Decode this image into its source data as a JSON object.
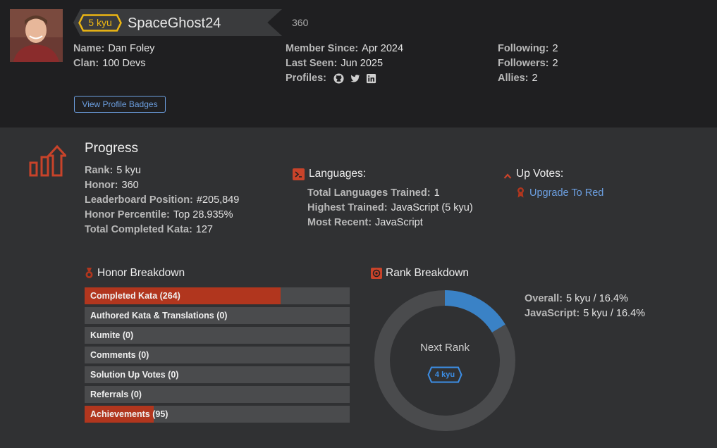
{
  "profile": {
    "rank": "5 kyu",
    "username": "SpaceGhost24",
    "honor": "360",
    "name_label": "Name:",
    "name": "Dan Foley",
    "clan_label": "Clan:",
    "clan": "100 Devs",
    "member_since_label": "Member Since:",
    "member_since": "Apr 2024",
    "last_seen_label": "Last Seen:",
    "last_seen": "Jun 2025",
    "profiles_label": "Profiles:",
    "profile_icons": [
      "github-icon",
      "twitter-icon",
      "linkedin-icon"
    ],
    "following_label": "Following:",
    "following": "2",
    "followers_label": "Followers:",
    "followers": "2",
    "allies_label": "Allies:",
    "allies": "2",
    "badges_button": "View Profile Badges"
  },
  "progress": {
    "title": "Progress",
    "rank_label": "Rank:",
    "rank": "5 kyu",
    "honor_label": "Honor:",
    "honor": "360",
    "leaderboard_label": "Leaderboard Position:",
    "leaderboard": "#205,849",
    "percentile_label": "Honor Percentile:",
    "percentile": "Top 28.935%",
    "completed_label": "Total Completed Kata:",
    "completed": "127"
  },
  "languages": {
    "title": "Languages:",
    "total_label": "Total Languages Trained:",
    "total": "1",
    "highest_label": "Highest Trained:",
    "highest": "JavaScript (5 kyu)",
    "recent_label": "Most Recent:",
    "recent": "JavaScript"
  },
  "upvotes": {
    "title": "Up Votes:",
    "upgrade_link": "Upgrade To Red"
  },
  "honor_breakdown": {
    "title": "Honor Breakdown",
    "items": [
      {
        "label": "Completed Kata (264)",
        "fraction": 0.74
      },
      {
        "label": "Authored Kata & Translations (0)",
        "fraction": 0
      },
      {
        "label": "Kumite (0)",
        "fraction": 0
      },
      {
        "label": "Comments (0)",
        "fraction": 0
      },
      {
        "label": "Solution Up Votes (0)",
        "fraction": 0
      },
      {
        "label": "Referrals (0)",
        "fraction": 0
      },
      {
        "label": "Achievements (95)",
        "fraction": 0.26
      }
    ]
  },
  "rank_breakdown": {
    "title": "Rank Breakdown",
    "overall_label": "Overall:",
    "overall": "5 kyu / 16.4%",
    "js_label": "JavaScript:",
    "js": "5 kyu / 16.4%",
    "progress_fraction": 0.164,
    "next_rank_label": "Next Rank",
    "next_rank": "4 kyu"
  },
  "colors": {
    "accent_red": "#b1361e",
    "rank_yellow": "#ecb613",
    "rank_blue": "#3c8ee6",
    "link_blue": "#6c9fe0"
  }
}
